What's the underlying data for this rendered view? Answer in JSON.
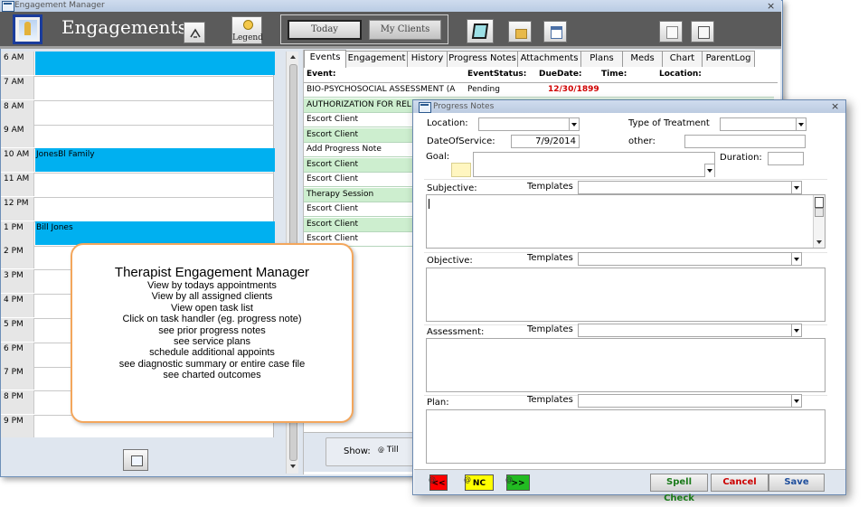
{
  "main_window": {
    "title": "Engagement Manager",
    "close_symbol": "×"
  },
  "header": {
    "app_title": "Engagements",
    "legend_label": "Legend",
    "today_label": "Today",
    "my_clients_label": "My Clients"
  },
  "schedule": {
    "rows": [
      {
        "time": "6 AM",
        "event": "",
        "highlight": true
      },
      {
        "time": "7 AM",
        "event": "",
        "highlight": false
      },
      {
        "time": "8 AM",
        "event": "",
        "highlight": false
      },
      {
        "time": "9 AM",
        "event": "",
        "highlight": false
      },
      {
        "time": "10 AM",
        "event": "JonesBl Family",
        "highlight": true
      },
      {
        "time": "11 AM",
        "event": "",
        "highlight": false
      },
      {
        "time": "12 PM",
        "event": "",
        "highlight": false
      },
      {
        "time": "1 PM",
        "event": "Bill Jones",
        "highlight": true
      },
      {
        "time": "2 PM",
        "event": "",
        "highlight": false
      },
      {
        "time": "3 PM",
        "event": "",
        "highlight": false
      },
      {
        "time": "4 PM",
        "event": "",
        "highlight": false
      },
      {
        "time": "5 PM",
        "event": "",
        "highlight": false
      },
      {
        "time": "6 PM",
        "event": "",
        "highlight": false
      },
      {
        "time": "7 PM",
        "event": "",
        "highlight": false
      },
      {
        "time": "8 PM",
        "event": "",
        "highlight": false
      },
      {
        "time": "9 PM",
        "event": "",
        "highlight": false
      }
    ],
    "highlight_color": "#00b0f0"
  },
  "tabs": [
    "Events",
    "Engagement",
    "History",
    "Progress Notes",
    "Attachments",
    "Plans",
    "Meds",
    "Chart",
    "ParentLog"
  ],
  "events": {
    "columns": {
      "event": "Event:",
      "status": "EventStatus:",
      "due": "DueDate:",
      "time": "Time:",
      "location": "Location:"
    },
    "rows": [
      {
        "event": "BIO-PSYCHOSOCIAL ASSESSMENT (A",
        "status": "Pending",
        "due": "12/30/1899",
        "alt": false
      },
      {
        "event": "AUTHORIZATION FOR REL",
        "status": "",
        "due": "",
        "alt": true
      },
      {
        "event": "Escort Client",
        "status": "",
        "due": "",
        "alt": false
      },
      {
        "event": "Escort Client",
        "status": "",
        "due": "",
        "alt": true
      },
      {
        "event": "Add Progress Note",
        "status": "",
        "due": "",
        "alt": false
      },
      {
        "event": "Escort Client",
        "status": "",
        "due": "",
        "alt": true
      },
      {
        "event": "Escort Client",
        "status": "",
        "due": "",
        "alt": false
      },
      {
        "event": "Therapy Session",
        "status": "",
        "due": "",
        "alt": true
      },
      {
        "event": "Escort Client",
        "status": "",
        "due": "",
        "alt": false
      },
      {
        "event": "Escort Client",
        "status": "",
        "due": "",
        "alt": true
      },
      {
        "event": "Escort Client",
        "status": "",
        "due": "",
        "alt": false
      }
    ]
  },
  "show_bar": {
    "label": "Show:",
    "option": "Till"
  },
  "callout": {
    "title": "Therapist Engagement Manager",
    "lines": [
      "View by todays appointments",
      "View by all assigned clients",
      "View open task list",
      "Click on task handler (eg. progress note)",
      "see prior progress notes",
      "see service plans",
      "schedule additional appoints",
      "see diagnostic summary or entire case file",
      "see charted outcomes"
    ]
  },
  "progress_notes": {
    "title": "Progress Notes",
    "close_symbol": "×",
    "location_label": "Location:",
    "type_of_treatment_label": "Type of Treatment",
    "date_of_service_label": "DateOfService:",
    "date_of_service_value": "7/9/2014",
    "other_label": "other:",
    "goal_label": "Goal:",
    "duration_label": "Duration:",
    "subjective_label": "Subjective:",
    "objective_label": "Objective:",
    "assessment_label": "Assessment:",
    "plan_label": "Plan:",
    "templates_label": "Templates",
    "nav_prev": "<<",
    "nav_nc": "NC",
    "nav_next": ">>",
    "radio_mark": "@",
    "spell_check": "Spell Check",
    "cancel": "Cancel",
    "save": "Save",
    "colors": {
      "prev": "#ff0000",
      "nc": "#ffff00",
      "next": "#22bb22",
      "spell": "#1a7a1a",
      "cancel": "#cc0000",
      "save": "#1f4e9c"
    }
  }
}
